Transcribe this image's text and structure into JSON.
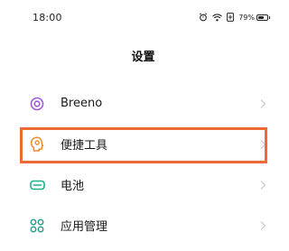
{
  "status_bar": {
    "time": "18:00",
    "battery_percent": "79%",
    "battery_level": 0.79
  },
  "header": {
    "title": "设置"
  },
  "settings": {
    "items": [
      {
        "label": "Breeno",
        "icon": "breeno-icon",
        "color": "#a05ad8"
      },
      {
        "label": "便捷工具",
        "icon": "convenience-tools-icon",
        "color": "#f08a2a"
      },
      {
        "label": "电池",
        "icon": "battery-icon",
        "color": "#18b48a"
      },
      {
        "label": "应用管理",
        "icon": "app-management-icon",
        "color": "#2a9e8a"
      }
    ]
  },
  "highlight": {
    "color": "#ee6a35",
    "target": "便捷工具"
  }
}
